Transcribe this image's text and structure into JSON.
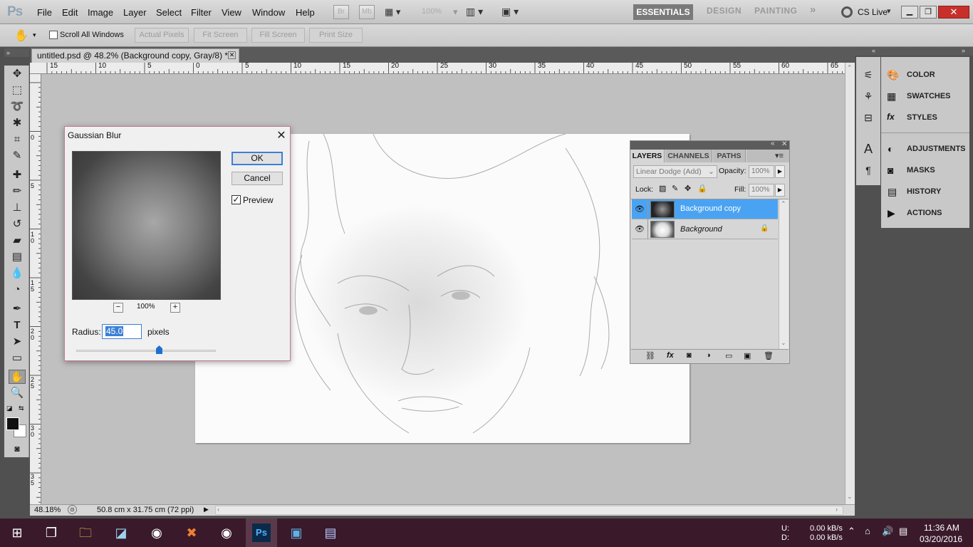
{
  "menubar": {
    "logo": "Ps",
    "items": [
      "File",
      "Edit",
      "Image",
      "Layer",
      "Select",
      "Filter",
      "View",
      "Window",
      "Help"
    ],
    "br_label": "Br",
    "mb_label": "Mb",
    "zoom_value": "100%",
    "workspaces": [
      "ESSENTIALS",
      "DESIGN",
      "PAINTING"
    ],
    "more": "»",
    "cs_live": "CS Live"
  },
  "options": {
    "scroll_all_windows": "Scroll All Windows",
    "buttons": [
      "Actual Pixels",
      "Fit Screen",
      "Fill Screen",
      "Print Size"
    ]
  },
  "document": {
    "tab_title": "untitled.psd @ 48.2% (Background copy, Gray/8) *",
    "zoom": "48.18%",
    "doc_size": "50.8 cm x 31.75 cm (72 ppi)"
  },
  "ruler_h": [
    "15",
    "10",
    "5",
    "0",
    "5",
    "10",
    "15",
    "20",
    "25",
    "30",
    "35",
    "40",
    "45",
    "50",
    "55",
    "60",
    "65"
  ],
  "ruler_v": [
    "0",
    "5",
    "1",
    "0",
    "1",
    "5",
    "2",
    "0",
    "2",
    "5",
    "3",
    "0",
    "3",
    "5"
  ],
  "dialog": {
    "title": "Gaussian Blur",
    "ok": "OK",
    "cancel": "Cancel",
    "preview": "Preview",
    "preview_checked": true,
    "zoom_out": "−",
    "zoom_in": "+",
    "zoom_value": "100%",
    "radius_label": "Radius:",
    "radius_value": "45.0",
    "radius_unit": "pixels",
    "radius_slider_fraction": 0.59
  },
  "layers_panel": {
    "tabs": [
      "LAYERS",
      "CHANNELS",
      "PATHS"
    ],
    "blend_mode": "Linear Dodge (Add)",
    "opacity_label": "Opacity:",
    "opacity_value": "100%",
    "lock_label": "Lock:",
    "fill_label": "Fill:",
    "fill_value": "100%",
    "layers": [
      {
        "name": "Background copy",
        "selected": true
      },
      {
        "name": "Background",
        "selected": false,
        "locked": true
      }
    ]
  },
  "dock": {
    "group1": [
      "COLOR",
      "SWATCHES",
      "STYLES"
    ],
    "group2": [
      "ADJUSTMENTS",
      "MASKS",
      "HISTORY",
      "ACTIONS"
    ]
  },
  "taskbar": {
    "upload_label": "U:",
    "download_label": "D:",
    "upload_speed": "0.00 kB/s",
    "download_speed": "0.00 kB/s",
    "time": "11:36 AM",
    "date": "03/20/2016"
  },
  "colors": {
    "accent": "#3c7fd5",
    "layer_selected": "#4aa3f2",
    "taskbar": "#3a1a2a"
  }
}
